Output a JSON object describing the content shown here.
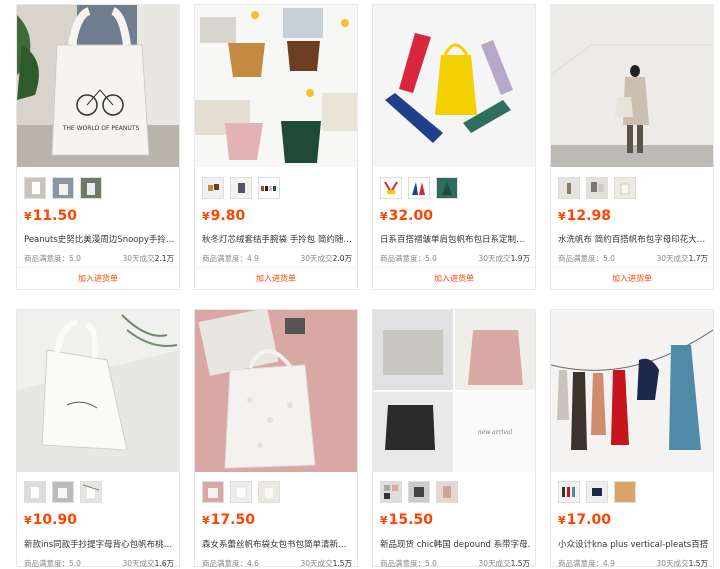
{
  "products": [
    {
      "price": "11.50",
      "title": "Peanuts史努比美漫周边Snoopy手拎…",
      "rating_label": "商品满意度：5.0",
      "sales_label": "30天成交",
      "sales": "2.1万",
      "add_label": "加入进货单"
    },
    {
      "price": "9.80",
      "title": "秋冬灯芯绒套结手腕袋 手拎包 简约随…",
      "rating_label": "商品满意度：4.9",
      "sales_label": "30天成交",
      "sales": "2.0万",
      "add_label": "加入进货单"
    },
    {
      "price": "32.00",
      "title": "日系百搭褶皱单肩包帆布包日系定制…",
      "rating_label": "商品满意度：5.0",
      "sales_label": "30天成交",
      "sales": "1.9万",
      "add_label": "加入进货单"
    },
    {
      "price": "12.98",
      "title": "水洗帆布 简约百搭帆布包字母印花大…",
      "rating_label": "商品满意度：5.0",
      "sales_label": "30天成交",
      "sales": "1.7万",
      "add_label": "加入进货单"
    },
    {
      "price": "10.90",
      "title": "新款ins同款手抄提字母背心包帆布桃…",
      "rating_label": "商品满意度：5.0",
      "sales_label": "30天成交",
      "sales": "1.6万",
      "add_label": ""
    },
    {
      "price": "17.50",
      "title": "森女系蕾丝帆布袋女包书包简单清新…",
      "rating_label": "商品满意度：4.6",
      "sales_label": "30天成交",
      "sales": "1.5万",
      "add_label": ""
    },
    {
      "price": "15.50",
      "title": "新品现货 chic韩国 depound 系带字母…",
      "rating_label": "商品满意度：5.0",
      "sales_label": "30天成交",
      "sales": "1.5万",
      "add_label": ""
    },
    {
      "price": "17.00",
      "title": "小众设计kna plus vertical-pleats百搭…",
      "rating_label": "商品满意度：4.9",
      "sales_label": "30天成交",
      "sales": "1.5万",
      "add_label": ""
    }
  ],
  "currency": "¥",
  "image_text": {
    "tote_print": "THE WORLD OF PEANUTS",
    "dress_caption": "new arrival"
  },
  "colors": {
    "price": "#ff4400",
    "border": "#e8e8e8"
  }
}
